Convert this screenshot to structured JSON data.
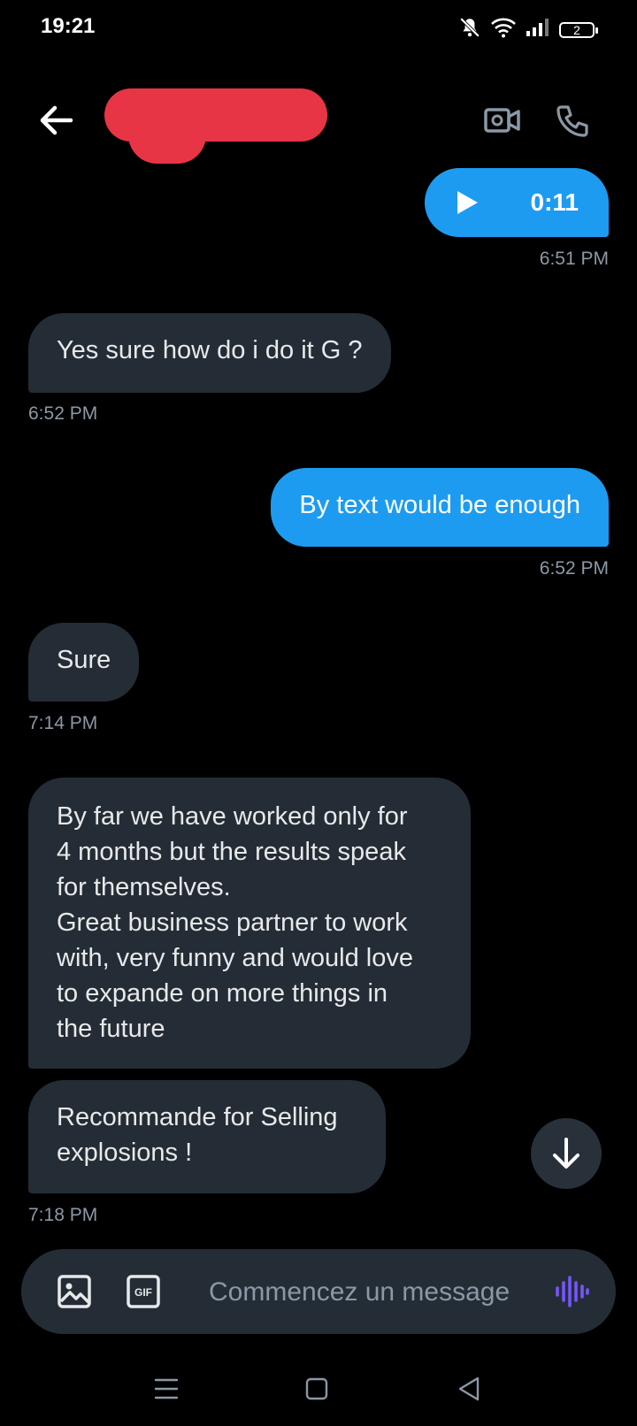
{
  "status_bar": {
    "time": "19:21",
    "icons": [
      "bell-muted-icon",
      "wifi-icon",
      "signal-icon"
    ],
    "battery_label": "2"
  },
  "header": {
    "back_icon": "arrow-left-icon",
    "contact_name_redacted": true,
    "actions": [
      "video-call-icon",
      "phone-icon"
    ]
  },
  "messages": [
    {
      "direction": "out",
      "type": "voice",
      "duration": "0:11",
      "time": "6:51 PM"
    },
    {
      "direction": "in",
      "type": "text",
      "text": "Yes sure how do i do it G ?",
      "time": "6:52 PM"
    },
    {
      "direction": "out",
      "type": "text",
      "text": "By text would be enough",
      "time": "6:52 PM"
    },
    {
      "direction": "in",
      "type": "text",
      "text": "Sure",
      "time": "7:14 PM"
    },
    {
      "direction": "in",
      "type": "text",
      "text": "By far we have worked only for\n4 months but the results speak\nfor themselves.\nGreat business partner to work\nwith, very funny and would love\nto expande on more things in\nthe future"
    },
    {
      "direction": "in",
      "type": "text",
      "text": "Recommande for Selling\nexplosions !",
      "time": "7:18 PM"
    }
  ],
  "composer": {
    "placeholder": "Commencez un message",
    "gif_label": "GIF",
    "icons": [
      "image-icon",
      "gif-icon",
      "voice-record-icon"
    ]
  },
  "colors": {
    "background": "#000000",
    "incoming_bubble": "#242d35",
    "outgoing_bubble": "#1d9bf0",
    "timestamp": "#8b98a5",
    "voice_accent": "#7856ff"
  },
  "nav_bar": [
    "menu-icon",
    "home-icon",
    "back-triangle-icon"
  ]
}
